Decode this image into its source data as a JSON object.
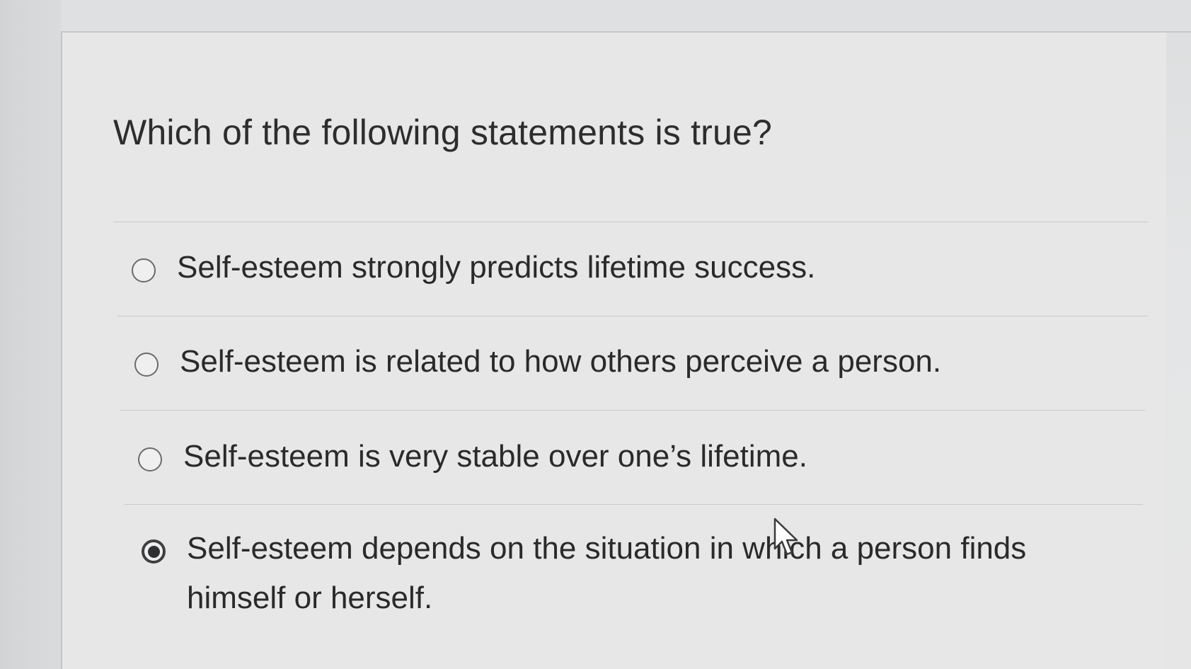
{
  "question": {
    "title": "Which of the following statements is true?"
  },
  "options": [
    {
      "label": "Self-esteem strongly predicts lifetime success.",
      "selected": false
    },
    {
      "label": "Self-esteem is related to how others perceive a person.",
      "selected": false
    },
    {
      "label": "Self-esteem is very stable over one’s lifetime.",
      "selected": false
    },
    {
      "label": "Self-esteem depends on the situation in which a person finds himself or herself.",
      "selected": true
    }
  ],
  "icons": {
    "radio_unchecked": "radio-unchecked-icon",
    "radio_checked": "radio-checked-icon",
    "cursor": "mouse-pointer-icon"
  },
  "colors": {
    "text": "#2a2a2a",
    "background": "#e7e7e8",
    "divider": "#c9cacc"
  }
}
